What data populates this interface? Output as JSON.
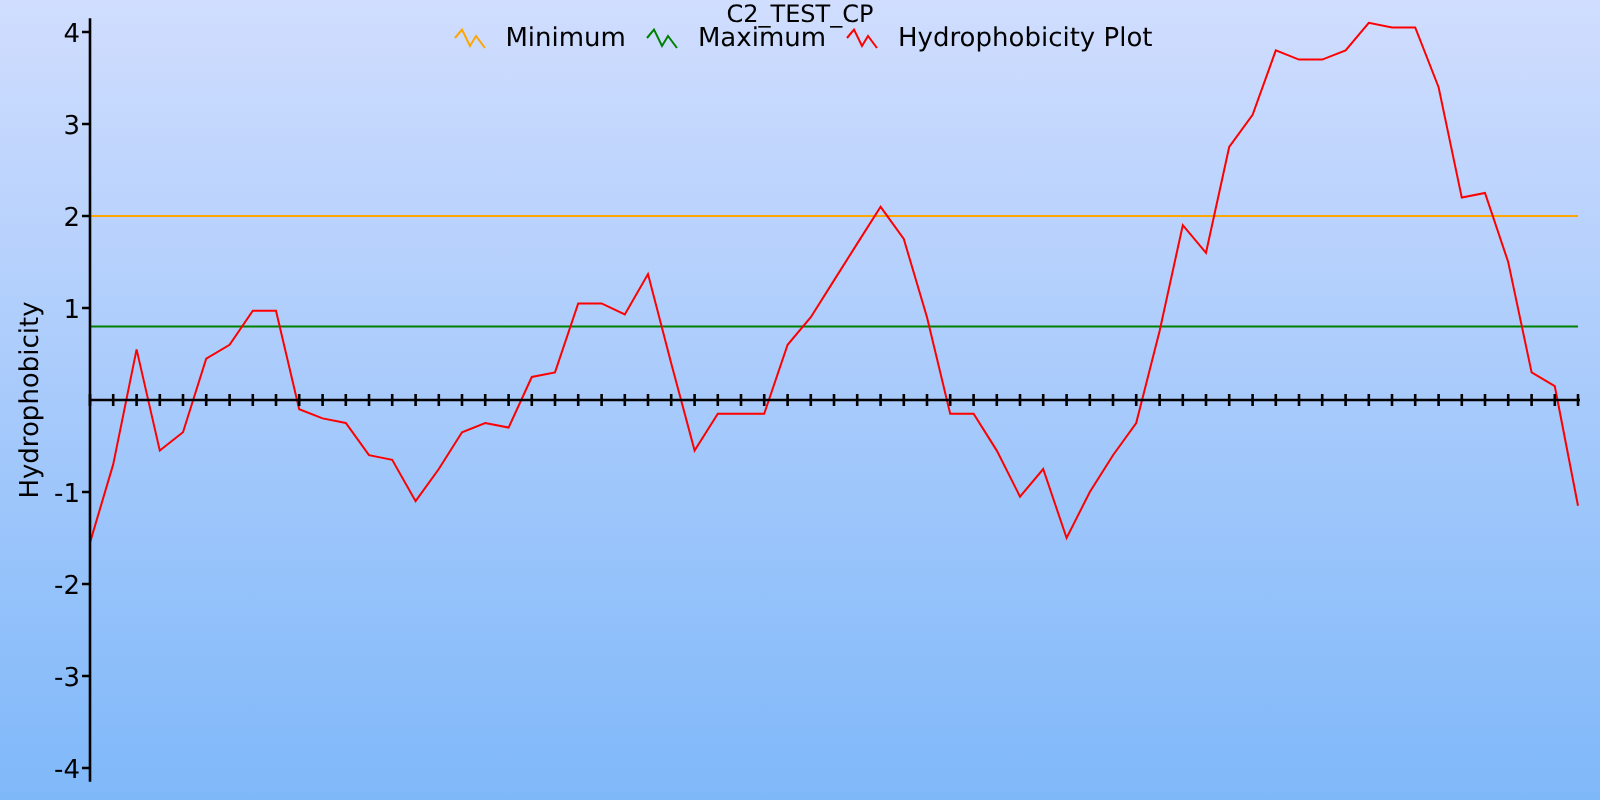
{
  "chart": {
    "chart_data": {
      "type": "line",
      "title": "C2_TEST_CP",
      "ylabel": "Hydrophobicity",
      "ylim": [
        -4.15,
        4.15
      ],
      "yticks": [
        -4,
        -3,
        -2,
        -1,
        1,
        2,
        3,
        4
      ],
      "series": [
        {
          "name": "Minimum",
          "color": "#ffa500",
          "values": [
            2,
            2,
            2,
            2,
            2,
            2,
            2,
            2,
            2,
            2,
            2,
            2,
            2,
            2,
            2,
            2,
            2,
            2,
            2,
            2,
            2,
            2,
            2,
            2,
            2,
            2,
            2,
            2,
            2,
            2,
            2,
            2,
            2,
            2,
            2,
            2,
            2,
            2,
            2,
            2,
            2,
            2,
            2,
            2,
            2,
            2,
            2,
            2,
            2,
            2,
            2,
            2,
            2,
            2,
            2,
            2,
            2,
            2,
            2,
            2,
            2,
            2,
            2,
            2,
            2
          ]
        },
        {
          "name": "Maximum",
          "color": "#008000",
          "values": [
            0.8,
            0.8,
            0.8,
            0.8,
            0.8,
            0.8,
            0.8,
            0.8,
            0.8,
            0.8,
            0.8,
            0.8,
            0.8,
            0.8,
            0.8,
            0.8,
            0.8,
            0.8,
            0.8,
            0.8,
            0.8,
            0.8,
            0.8,
            0.8,
            0.8,
            0.8,
            0.8,
            0.8,
            0.8,
            0.8,
            0.8,
            0.8,
            0.8,
            0.8,
            0.8,
            0.8,
            0.8,
            0.8,
            0.8,
            0.8,
            0.8,
            0.8,
            0.8,
            0.8,
            0.8,
            0.8,
            0.8,
            0.8,
            0.8,
            0.8,
            0.8,
            0.8,
            0.8,
            0.8,
            0.8,
            0.8,
            0.8,
            0.8,
            0.8,
            0.8,
            0.8,
            0.8,
            0.8,
            0.8,
            0.8
          ]
        },
        {
          "name": "Hydrophobicity Plot",
          "color": "#ff0000",
          "values": [
            -1.55,
            -0.7,
            0.55,
            -0.55,
            -0.35,
            0.45,
            0.6,
            0.97,
            0.97,
            -0.1,
            -0.2,
            -0.25,
            -0.6,
            -0.65,
            -1.1,
            -0.75,
            -0.35,
            -0.25,
            -0.3,
            0.25,
            0.3,
            1.05,
            1.05,
            0.93,
            1.37,
            0.4,
            -0.55,
            -0.15,
            -0.15,
            -0.15,
            0.6,
            0.9,
            1.3,
            1.7,
            2.1,
            1.75,
            0.9,
            -0.15,
            -0.15,
            -0.55,
            -1.05,
            -0.75,
            -1.5,
            -1.0,
            -0.6,
            -0.25,
            0.75,
            1.9,
            1.6,
            2.75,
            3.1,
            3.8,
            3.7,
            3.7,
            3.8,
            4.1,
            4.05,
            4.05,
            3.4,
            2.2,
            2.25,
            1.5,
            0.3,
            0.15,
            -1.15
          ]
        }
      ]
    }
  }
}
